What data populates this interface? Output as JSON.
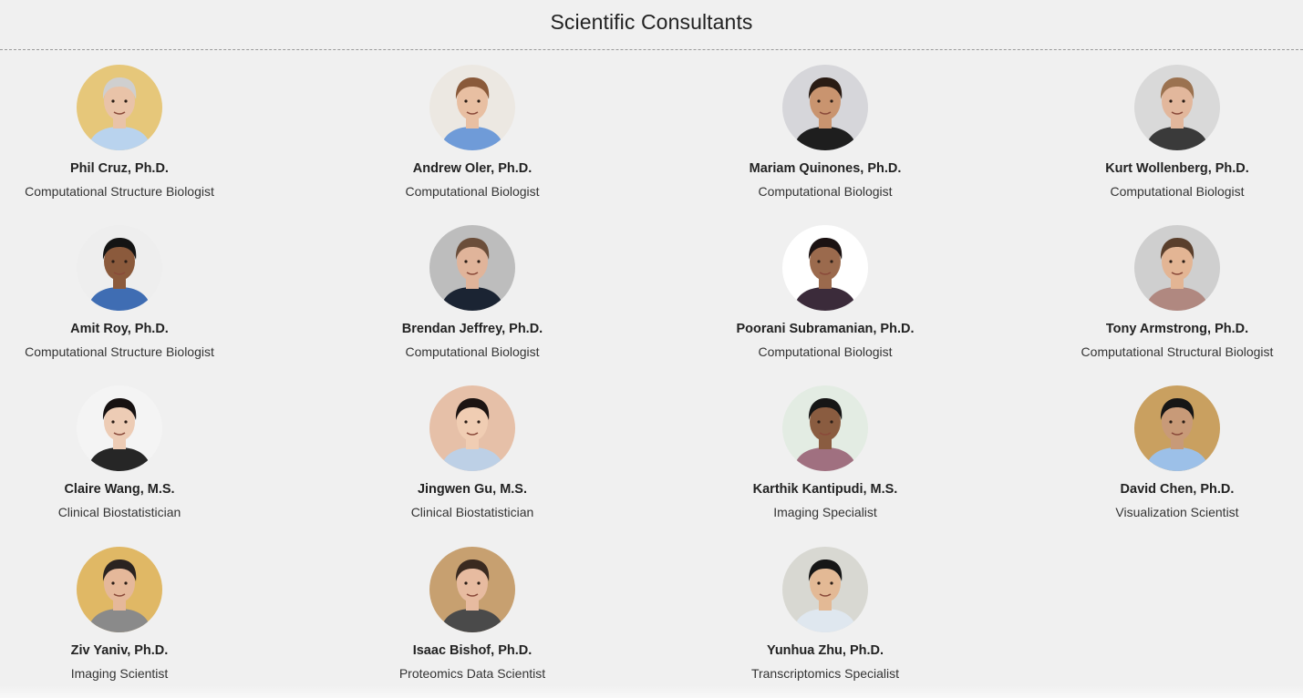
{
  "page": {
    "title": "Scientific Consultants"
  },
  "consultants": [
    {
      "name": "Phil Cruz, Ph.D.",
      "role": "Computational Structure Biologist",
      "bg": "#e6c77a",
      "skin": "#e9c3a8",
      "hair": "#cfcfcf",
      "shirt": "#b9d3ee"
    },
    {
      "name": "Andrew Oler, Ph.D.",
      "role": "Computational Biologist",
      "bg": "#ece8e2",
      "skin": "#e8bfa2",
      "hair": "#8a5a3a",
      "shirt": "#6f9bd8"
    },
    {
      "name": "Mariam Quinones, Ph.D.",
      "role": "Computational Biologist",
      "bg": "#d6d6da",
      "skin": "#c9946f",
      "hair": "#2a1c14",
      "shirt": "#1e1e1e"
    },
    {
      "name": "Kurt Wollenberg, Ph.D.",
      "role": "Computational Biologist",
      "bg": "#d9d9d9",
      "skin": "#e2b79c",
      "hair": "#9b7250",
      "shirt": "#3a3a3a"
    },
    {
      "name": "Amit Roy, Ph.D.",
      "role": "Computational Structure Biologist",
      "bg": "#eeeeee",
      "skin": "#8b5a3c",
      "hair": "#141414",
      "shirt": "#3f6db3"
    },
    {
      "name": "Brendan Jeffrey, Ph.D.",
      "role": "Computational Biologist",
      "bg": "#bdbdbd",
      "skin": "#e0b49a",
      "hair": "#6b4e3a",
      "shirt": "#1b2433"
    },
    {
      "name": "Poorani Subramanian, Ph.D.",
      "role": "Computational Biologist",
      "bg": "#ffffff",
      "skin": "#9b6a4d",
      "hair": "#1b1212",
      "shirt": "#3b2b3a"
    },
    {
      "name": "Tony Armstrong, Ph.D.",
      "role": "Computational Structural Biologist",
      "bg": "#cfcfcf",
      "skin": "#e3b594",
      "hair": "#5a3f2c",
      "shirt": "#b08880"
    },
    {
      "name": "Claire Wang, M.S.",
      "role": "Clinical Biostatistician",
      "bg": "#f4f4f4",
      "skin": "#edccb5",
      "hair": "#161111",
      "shirt": "#262626"
    },
    {
      "name": "Jingwen Gu, M.S.",
      "role": "Clinical Biostatistician",
      "bg": "#e6c0a8",
      "skin": "#f0cdb3",
      "hair": "#1c1412",
      "shirt": "#bdd0e6"
    },
    {
      "name": "Karthik Kantipudi, M.S.",
      "role": "Imaging Specialist",
      "bg": "#e3ece3",
      "skin": "#8a5c40",
      "hair": "#161616",
      "shirt": "#a07080"
    },
    {
      "name": "David Chen, Ph.D.",
      "role": "Visualization Scientist",
      "bg": "#c9a060",
      "skin": "#c89a78",
      "hair": "#161616",
      "shirt": "#9cc0e8"
    },
    {
      "name": "Ziv Yaniv, Ph.D.",
      "role": "Imaging Scientist",
      "bg": "#e0b865",
      "skin": "#e5b89a",
      "hair": "#2a2320",
      "shirt": "#8a8a8a"
    },
    {
      "name": "Isaac Bishof, Ph.D.",
      "role": "Proteomics Data Scientist",
      "bg": "#c7a070",
      "skin": "#e7bba0",
      "hair": "#3a2a20",
      "shirt": "#4a4a4a"
    },
    {
      "name": "Yunhua Zhu, Ph.D.",
      "role": "Transcriptomics Specialist",
      "bg": "#d8d8d2",
      "skin": "#e3b995",
      "hair": "#161616",
      "shirt": "#dfe7ef"
    }
  ]
}
